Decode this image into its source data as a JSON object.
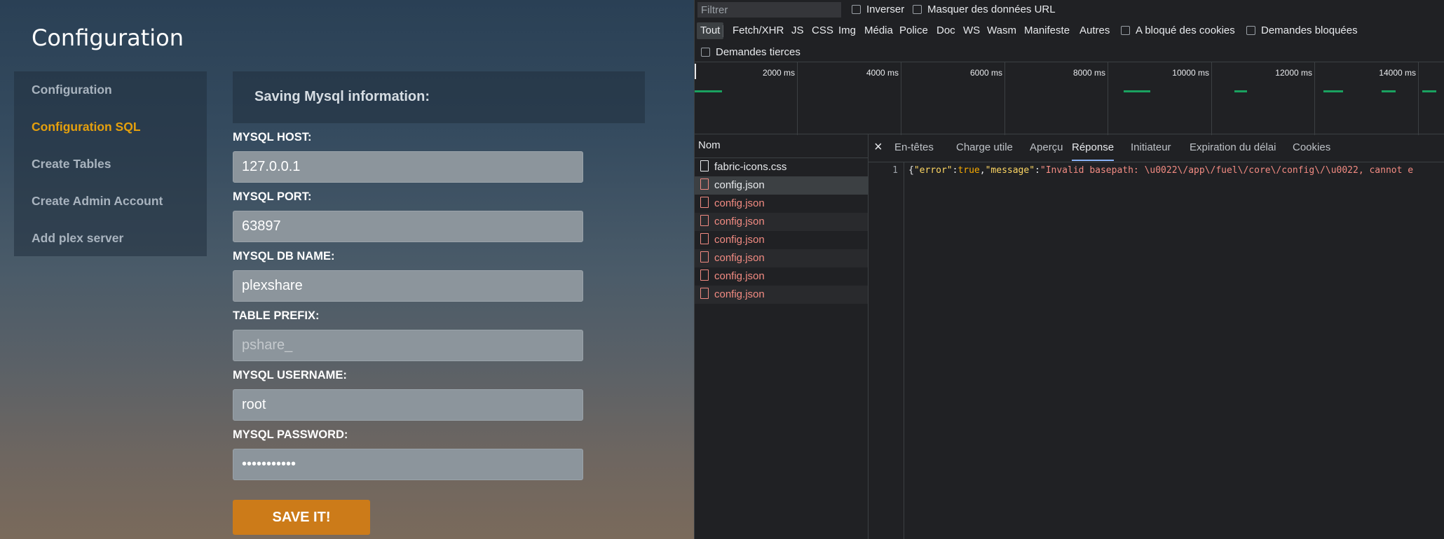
{
  "app": {
    "title": "Configuration",
    "nav": [
      {
        "label": "Configuration"
      },
      {
        "label": "Configuration SQL"
      },
      {
        "label": "Create Tables"
      },
      {
        "label": "Create Admin Account"
      },
      {
        "label": "Add plex server"
      }
    ],
    "panel_title": "Saving Mysql information:",
    "fields": [
      {
        "label": "MYSQL HOST:",
        "value": "127.0.0.1",
        "placeholder": ""
      },
      {
        "label": "MYSQL PORT:",
        "value": "63897",
        "placeholder": ""
      },
      {
        "label": "MYSQL DB NAME:",
        "value": "plexshare",
        "placeholder": ""
      },
      {
        "label": "TABLE PREFIX:",
        "value": "",
        "placeholder": "pshare_"
      },
      {
        "label": "MYSQL USERNAME:",
        "value": "root",
        "placeholder": ""
      },
      {
        "label": "MYSQL PASSWORD:",
        "value": "•••••••••••",
        "placeholder": ""
      }
    ],
    "save_label": "SAVE IT!",
    "colors": {
      "accent": "#e5a00d",
      "button": "#cc7b19"
    }
  },
  "devtools": {
    "filter_placeholder": "Filtrer",
    "invert_label": "Inverser",
    "hide_data_urls_label": "Masquer des données URL",
    "types": [
      "Tout",
      "Fetch/XHR",
      "JS",
      "CSS",
      "Img",
      "Média",
      "Police",
      "Doc",
      "WS",
      "Wasm",
      "Manifeste",
      "Autres"
    ],
    "blocked_cookies_label": "A bloqué des cookies",
    "blocked_requests_label": "Demandes bloquées",
    "third_party_label": "Demandes tierces",
    "timeline_ticks": [
      "2000 ms",
      "4000 ms",
      "6000 ms",
      "8000 ms",
      "10000 ms",
      "12000 ms",
      "14000 ms"
    ],
    "requests_header": "Nom",
    "requests": [
      {
        "name": "fabric-icons.css",
        "status": "ok"
      },
      {
        "name": "config.json",
        "status": "selected"
      },
      {
        "name": "config.json",
        "status": "error"
      },
      {
        "name": "config.json",
        "status": "error"
      },
      {
        "name": "config.json",
        "status": "error"
      },
      {
        "name": "config.json",
        "status": "error"
      },
      {
        "name": "config.json",
        "status": "error"
      },
      {
        "name": "config.json",
        "status": "error"
      }
    ],
    "tabs": [
      "En-têtes",
      "Charge utile",
      "Aperçu",
      "Réponse",
      "Initiateur",
      "Expiration du délai",
      "Cookies"
    ],
    "active_tab": "Réponse",
    "response": {
      "line_number": "1",
      "key_error": "\"error\"",
      "val_error": "true",
      "key_message": "\"message\"",
      "val_message": "\"Invalid basepath: \\u0022\\/app\\/fuel\\/core\\/config\\/\\u0022, cannot e"
    },
    "colors": {
      "network_bar": "#1aa260",
      "error_text": "#f28b82",
      "active_tab_underline": "#8ab4f8"
    }
  }
}
